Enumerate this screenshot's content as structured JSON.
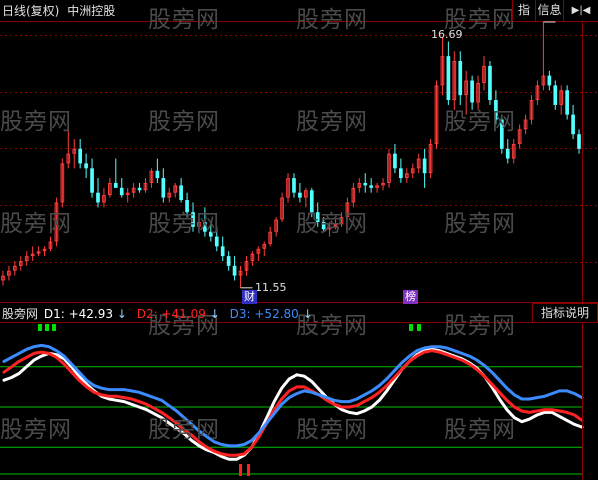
{
  "header": {
    "period_label": "日线(复权)",
    "stock_name": "中洲控股",
    "btn_indicator": "指",
    "btn_info": "信息",
    "btn_arrow": "▶|◀"
  },
  "watermark": "股旁网",
  "price_pane": {
    "high_label": "16.69",
    "low_label": "11.55",
    "tag_cai": "财",
    "tag_bang": "榜"
  },
  "indicator": {
    "name": "股旁网",
    "d1_label": "D1:",
    "d1_value": "+42.93",
    "d2_label": "D2:",
    "d2_value": "+41.09",
    "d3_label": "D3:",
    "d3_value": "+52.80",
    "explain_button": "指标说明"
  },
  "colors": {
    "up": "#ff3c3c",
    "down": "#54ffff",
    "grid_red": "#8a0000",
    "d1": "#ffffff",
    "d2": "#ff2222",
    "d3": "#3c8cff",
    "hline": "#00c000",
    "signal_green": "#00e000",
    "signal_red": "#ff2020"
  },
  "chart_data": {
    "type": "candlestick",
    "ohlc": [
      [
        11.7,
        11.9,
        11.6,
        11.8
      ],
      [
        11.8,
        12.0,
        11.7,
        11.9
      ],
      [
        11.9,
        12.1,
        11.8,
        12.0
      ],
      [
        12.0,
        12.2,
        11.9,
        12.1
      ],
      [
        12.1,
        12.3,
        12.0,
        12.2
      ],
      [
        12.2,
        12.4,
        12.1,
        12.25
      ],
      [
        12.25,
        12.4,
        12.2,
        12.3
      ],
      [
        12.3,
        12.4,
        12.2,
        12.35
      ],
      [
        12.35,
        12.6,
        12.3,
        12.5
      ],
      [
        12.5,
        13.4,
        12.4,
        13.3
      ],
      [
        13.3,
        14.2,
        13.2,
        14.1
      ],
      [
        14.1,
        15.0,
        14.0,
        14.3
      ],
      [
        14.3,
        14.6,
        14.0,
        14.4
      ],
      [
        14.4,
        14.6,
        14.0,
        14.1
      ],
      [
        14.1,
        14.3,
        13.8,
        14.0
      ],
      [
        14.0,
        14.2,
        13.4,
        13.5
      ],
      [
        13.5,
        13.8,
        13.2,
        13.3
      ],
      [
        13.3,
        13.6,
        13.2,
        13.45
      ],
      [
        13.45,
        13.8,
        13.4,
        13.7
      ],
      [
        13.7,
        14.2,
        13.6,
        13.6
      ],
      [
        13.6,
        13.8,
        13.4,
        13.45
      ],
      [
        13.45,
        13.6,
        13.3,
        13.5
      ],
      [
        13.5,
        13.7,
        13.4,
        13.6
      ],
      [
        13.6,
        13.7,
        13.5,
        13.55
      ],
      [
        13.55,
        13.8,
        13.5,
        13.7
      ],
      [
        13.7,
        14.0,
        13.6,
        13.95
      ],
      [
        13.95,
        14.2,
        13.7,
        13.8
      ],
      [
        13.8,
        14.0,
        13.3,
        13.4
      ],
      [
        13.4,
        13.6,
        13.3,
        13.5
      ],
      [
        13.5,
        13.7,
        13.4,
        13.65
      ],
      [
        13.65,
        13.8,
        13.3,
        13.35
      ],
      [
        13.35,
        13.5,
        13.0,
        13.1
      ],
      [
        13.1,
        13.3,
        12.7,
        12.8
      ],
      [
        12.8,
        13.0,
        12.7,
        12.9
      ],
      [
        12.9,
        13.2,
        12.6,
        12.7
      ],
      [
        12.7,
        12.9,
        12.5,
        12.6
      ],
      [
        12.6,
        12.8,
        12.3,
        12.4
      ],
      [
        12.4,
        12.6,
        12.1,
        12.2
      ],
      [
        12.2,
        12.3,
        11.9,
        12.0
      ],
      [
        12.0,
        12.2,
        11.7,
        11.8
      ],
      [
        11.8,
        12.0,
        11.55,
        11.9
      ],
      [
        11.9,
        12.2,
        11.8,
        12.1
      ],
      [
        12.1,
        12.3,
        12.0,
        12.25
      ],
      [
        12.25,
        12.4,
        12.1,
        12.35
      ],
      [
        12.35,
        12.5,
        12.2,
        12.45
      ],
      [
        12.45,
        12.8,
        12.4,
        12.7
      ],
      [
        12.7,
        13.0,
        12.6,
        12.95
      ],
      [
        12.95,
        13.5,
        12.9,
        13.4
      ],
      [
        13.4,
        13.9,
        13.3,
        13.8
      ],
      [
        13.8,
        13.9,
        13.4,
        13.5
      ],
      [
        13.5,
        13.7,
        13.3,
        13.4
      ],
      [
        13.4,
        13.6,
        13.2,
        13.55
      ],
      [
        13.55,
        13.6,
        13.0,
        13.1
      ],
      [
        13.1,
        13.3,
        12.8,
        12.9
      ],
      [
        12.9,
        13.0,
        12.7,
        12.75
      ],
      [
        12.75,
        12.9,
        12.6,
        12.8
      ],
      [
        12.8,
        12.95,
        12.75,
        12.85
      ],
      [
        12.85,
        13.1,
        12.8,
        13.0
      ],
      [
        13.0,
        13.4,
        12.95,
        13.3
      ],
      [
        13.3,
        13.7,
        13.2,
        13.6
      ],
      [
        13.6,
        13.8,
        13.5,
        13.7
      ],
      [
        13.7,
        13.9,
        13.5,
        13.65
      ],
      [
        13.65,
        13.8,
        13.5,
        13.6
      ],
      [
        13.6,
        13.7,
        13.5,
        13.65
      ],
      [
        13.65,
        13.8,
        13.55,
        13.7
      ],
      [
        13.7,
        14.4,
        13.6,
        14.3
      ],
      [
        14.3,
        14.5,
        13.9,
        14.0
      ],
      [
        14.0,
        14.2,
        13.7,
        13.8
      ],
      [
        13.8,
        14.0,
        13.7,
        13.9
      ],
      [
        13.9,
        14.1,
        13.8,
        14.0
      ],
      [
        14.0,
        14.3,
        13.9,
        14.2
      ],
      [
        14.2,
        14.4,
        13.6,
        13.9
      ],
      [
        13.9,
        14.6,
        13.8,
        14.5
      ],
      [
        14.5,
        15.8,
        14.4,
        15.7
      ],
      [
        15.7,
        16.69,
        15.5,
        16.3
      ],
      [
        16.3,
        16.6,
        15.3,
        15.4
      ],
      [
        15.4,
        16.4,
        15.2,
        16.2
      ],
      [
        16.2,
        16.4,
        15.3,
        15.5
      ],
      [
        15.5,
        16.0,
        15.1,
        15.8
      ],
      [
        15.8,
        15.9,
        15.2,
        15.35
      ],
      [
        15.35,
        15.9,
        15.2,
        15.75
      ],
      [
        15.75,
        16.3,
        15.6,
        16.1
      ],
      [
        16.1,
        16.2,
        15.3,
        15.4
      ],
      [
        15.4,
        15.6,
        14.9,
        15.0
      ],
      [
        15.0,
        15.1,
        14.3,
        14.4
      ],
      [
        14.4,
        14.6,
        14.1,
        14.2
      ],
      [
        14.2,
        14.6,
        14.1,
        14.5
      ],
      [
        14.5,
        14.9,
        14.4,
        14.8
      ],
      [
        14.8,
        15.1,
        14.7,
        15.0
      ],
      [
        15.0,
        15.5,
        14.9,
        15.4
      ],
      [
        15.4,
        15.8,
        15.3,
        15.7
      ],
      [
        15.7,
        17.0,
        15.6,
        15.9
      ],
      [
        15.9,
        16.0,
        15.6,
        15.7
      ],
      [
        15.7,
        15.8,
        15.2,
        15.3
      ],
      [
        15.3,
        15.7,
        15.1,
        15.6
      ],
      [
        15.6,
        15.7,
        15.0,
        15.1
      ],
      [
        15.1,
        15.3,
        14.6,
        14.7
      ],
      [
        14.7,
        14.8,
        14.3,
        14.4
      ]
    ],
    "indicator_lines": {
      "D1": [
        70,
        72,
        75,
        80,
        85,
        88,
        90,
        89,
        86,
        80,
        73,
        67,
        62,
        58,
        56,
        55,
        54,
        52,
        50,
        48,
        45,
        42,
        38,
        34,
        30,
        25,
        21,
        18,
        16,
        13,
        11,
        11,
        14,
        20,
        30,
        42,
        54,
        64,
        71,
        74,
        73,
        69,
        63,
        57,
        52,
        48,
        46,
        45,
        47,
        50,
        55,
        62,
        70,
        78,
        84,
        89,
        92,
        93,
        92,
        90,
        88,
        86,
        83,
        79,
        73,
        65,
        56,
        48,
        42,
        39,
        41,
        44,
        46,
        46,
        43,
        40,
        37,
        35
      ],
      "D2": [
        76,
        80,
        84,
        87,
        90,
        91,
        90,
        87,
        82,
        76,
        70,
        65,
        61,
        59,
        58,
        58,
        57,
        56,
        54,
        52,
        49,
        46,
        42,
        38,
        33,
        29,
        24,
        20,
        17,
        15,
        14,
        14,
        15,
        20,
        28,
        38,
        48,
        56,
        62,
        65,
        65,
        62,
        59,
        55,
        52,
        50,
        50,
        51,
        54,
        57,
        61,
        66,
        72,
        78,
        84,
        88,
        91,
        92,
        91,
        89,
        87,
        85,
        82,
        78,
        73,
        67,
        61,
        55,
        50,
        47,
        46,
        47,
        48,
        48,
        47,
        46,
        44,
        40
      ],
      "D3": [
        84,
        87,
        90,
        93,
        95,
        96,
        95,
        92,
        88,
        82,
        76,
        70,
        66,
        64,
        63,
        63,
        63,
        62,
        61,
        59,
        57,
        55,
        51,
        47,
        42,
        37,
        32,
        28,
        24,
        22,
        21,
        21,
        22,
        25,
        31,
        38,
        45,
        52,
        57,
        60,
        62,
        61,
        59,
        57,
        55,
        54,
        54,
        56,
        59,
        62,
        66,
        71,
        77,
        83,
        88,
        92,
        94,
        95,
        95,
        94,
        92,
        90,
        88,
        85,
        81,
        76,
        70,
        64,
        59,
        56,
        56,
        57,
        58,
        60,
        62,
        62,
        60,
        57
      ],
      "levels": [
        80,
        50,
        20,
        0
      ]
    }
  }
}
